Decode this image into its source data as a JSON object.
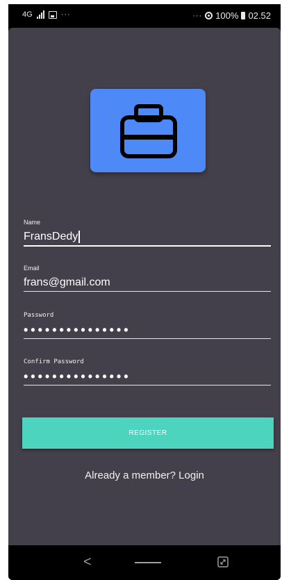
{
  "status_bar": {
    "network": "4G",
    "more": "···",
    "right_more": "···",
    "battery": "100%",
    "time": "02.52"
  },
  "app": {
    "logo_icon": "briefcase-icon",
    "accent_color": "#4d8af7",
    "background_color": "#433f4b"
  },
  "form": {
    "name": {
      "label": "Name",
      "value": "FransDedy"
    },
    "email": {
      "label": "Email",
      "value": "frans@gmail.com"
    },
    "password": {
      "label": "Password",
      "value": "•••••••••••••••"
    },
    "confirm_password": {
      "label": "Confirm Password",
      "value": "•••••••••••••••"
    }
  },
  "register_button": {
    "label": "REGISTER",
    "color": "#4dd4bf"
  },
  "login_link": {
    "label": "Already a member? Login"
  },
  "nav_bar": {
    "back": "<"
  }
}
